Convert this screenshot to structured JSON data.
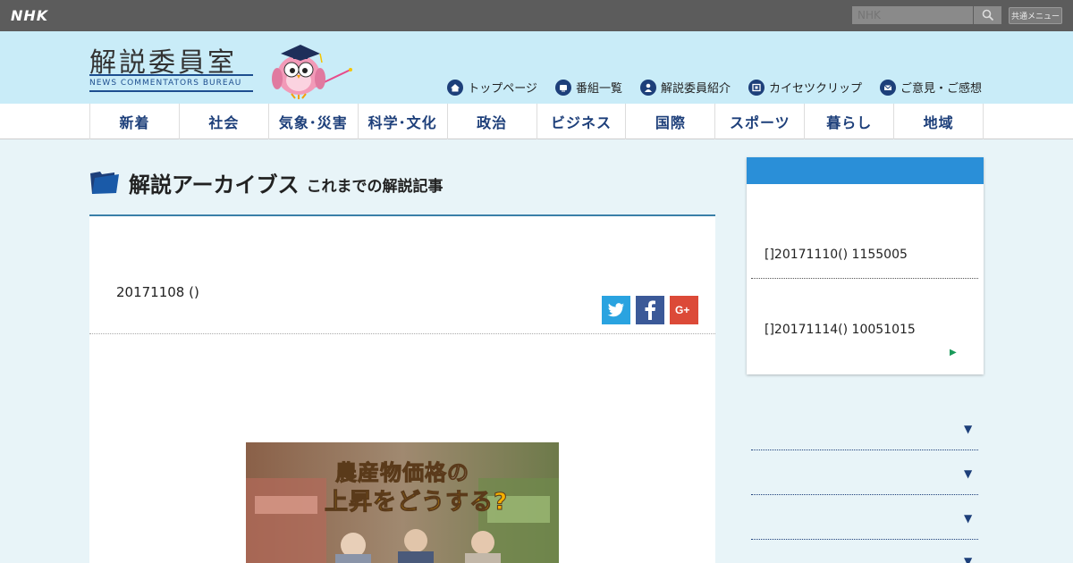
{
  "topbar": {
    "logo": "NHK",
    "search_placeholder": "NHK",
    "common_menu": "共通メニュー"
  },
  "header": {
    "title": "解説委員室",
    "subtitle": "NEWS COMMENTATORS BUREAU",
    "links": [
      {
        "label": "トップページ",
        "icon": "home-icon"
      },
      {
        "label": "番組一覧",
        "icon": "tv-icon"
      },
      {
        "label": "解説委員紹介",
        "icon": "person-icon"
      },
      {
        "label": "カイセツクリップ",
        "icon": "film-icon"
      },
      {
        "label": "ご意見・ご感想",
        "icon": "mail-icon"
      }
    ]
  },
  "nav": {
    "items": [
      "新着",
      "社会",
      "気象･災害",
      "科学･文化",
      "政治",
      "ビジネス",
      "国際",
      "スポーツ",
      "暮らし",
      "地域"
    ]
  },
  "archive": {
    "title": "解説アーカイブス",
    "subtitle": "これまでの解説記事"
  },
  "article": {
    "date": "20171108 ()",
    "image_text_1": "農産物価格の",
    "image_text_2": "上昇をどうする?"
  },
  "share": [
    "twitter",
    "facebook",
    "google-plus"
  ],
  "sidebar": {
    "items": [
      "[]20171110() 1155005",
      "[]20171114() 10051015"
    ]
  },
  "colors": {
    "header_bg": "#c9ecf8",
    "nav_text": "#1d3f7a",
    "sidebar_head": "#2a8fd8",
    "page_bg": "#e8f4f8"
  }
}
